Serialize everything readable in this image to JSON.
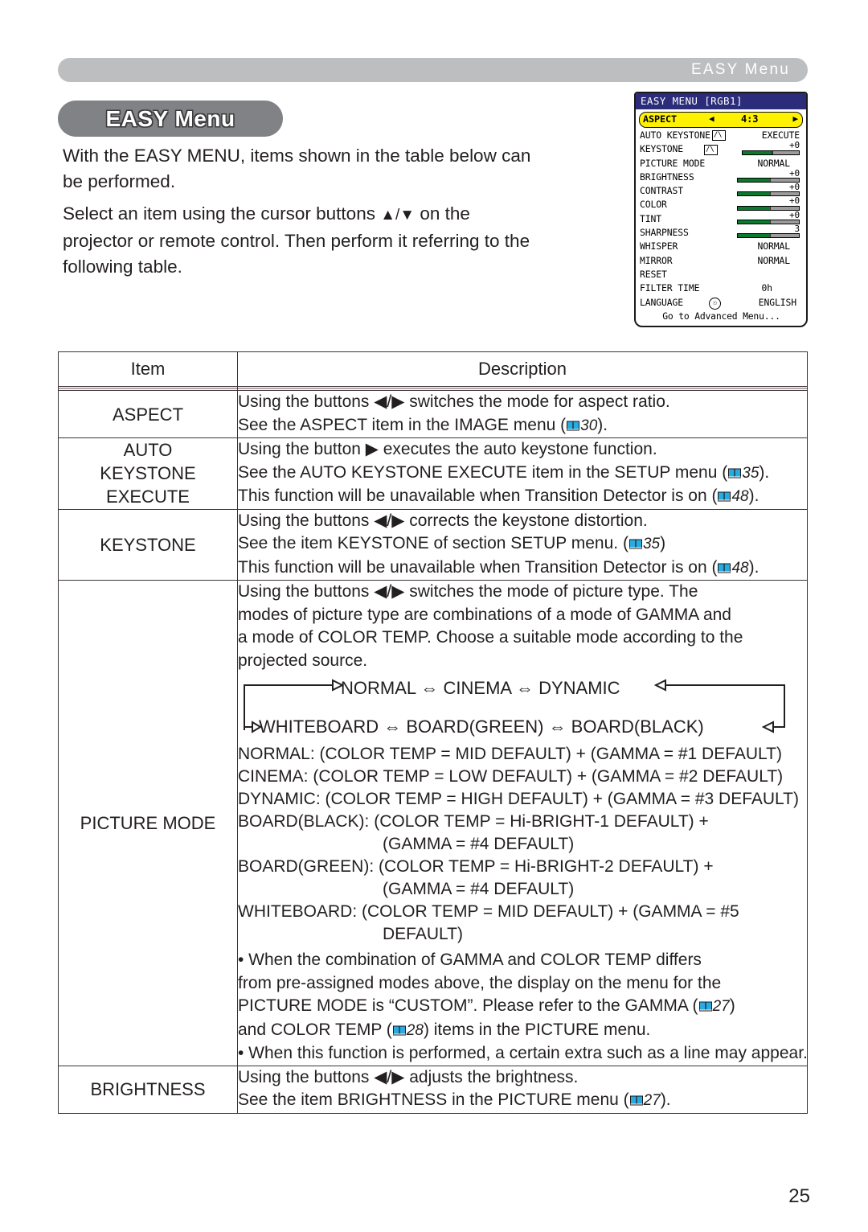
{
  "header": {
    "title": "EASY Menu"
  },
  "section": {
    "badge": "EASY Menu"
  },
  "intro": {
    "p1_line1": "With the EASY MENU, items shown in the table below can",
    "p1_line2": "be performed.",
    "p2_line1a": "Select an item using the cursor buttons ",
    "p2_symbols": "▲/▼",
    "p2_line1b": " on the",
    "p2_line2": "projector or remote control. Then perform it referring to the",
    "p2_line3": "following table."
  },
  "osd": {
    "title": "EASY MENU [RGB1]",
    "selected": {
      "label": "ASPECT",
      "value": "4:3",
      "left_arrow": "◀",
      "right_arrow": "▶"
    },
    "rows": [
      {
        "label": "AUTO KEYSTONE",
        "icon": "keystone-icon",
        "value": "EXECUTE",
        "type": "text"
      },
      {
        "label": "KEYSTONE",
        "icon": "keystone-icon",
        "value": "+0",
        "type": "bar",
        "fill": 52
      },
      {
        "label": "PICTURE MODE",
        "value": "NORMAL",
        "type": "text"
      },
      {
        "label": "BRIGHTNESS",
        "value": "+0",
        "type": "bar",
        "fill": 52
      },
      {
        "label": "CONTRAST",
        "value": "+0",
        "type": "bar",
        "fill": 52
      },
      {
        "label": "COLOR",
        "value": "+0",
        "type": "bar",
        "fill": 52
      },
      {
        "label": "TINT",
        "value": "+0",
        "type": "bar",
        "fill": 52
      },
      {
        "label": "SHARPNESS",
        "value": "3",
        "type": "bar",
        "fill": 52
      },
      {
        "label": "WHISPER",
        "value": "NORMAL",
        "type": "text"
      },
      {
        "label": "MIRROR",
        "value": "NORMAL",
        "type": "text"
      },
      {
        "label": "RESET",
        "value": "",
        "type": "text"
      },
      {
        "label": "FILTER TIME",
        "value": "0h",
        "type": "text"
      },
      {
        "label": "LANGUAGE",
        "icon": "globe-icon",
        "value": "ENGLISH",
        "type": "text"
      }
    ],
    "footer": "Go to Advanced Menu..."
  },
  "table": {
    "headers": {
      "item": "Item",
      "description": "Description"
    },
    "rows": [
      {
        "item": "ASPECT",
        "desc": [
          "Using the buttons ◀/▶ switches the mode for aspect ratio.",
          "See the ASPECT item in the IMAGE menu (▯30)."
        ],
        "lines": [
          {
            "pre": "Using the buttons ◀/▶ switches the mode for aspect ratio.",
            "ref": null,
            "post": ""
          },
          {
            "pre": "See the ASPECT item in the IMAGE menu (",
            "ref": "30",
            "post": ")."
          }
        ]
      },
      {
        "item": "AUTO\nKEYSTONE\nEXECUTE",
        "item_lines": [
          "AUTO",
          "KEYSTONE",
          "EXECUTE"
        ],
        "lines": [
          {
            "pre": "Using the button ▶ executes the auto keystone function.",
            "ref": null,
            "post": ""
          },
          {
            "pre": "See the AUTO KEYSTONE EXECUTE item in the SETUP menu (",
            "ref": "35",
            "post": ")."
          },
          {
            "pre": "This function will be unavailable when Transition Detector is on (",
            "ref": "48",
            "post": ")."
          }
        ]
      },
      {
        "item": "KEYSTONE",
        "item_lines": [
          "KEYSTONE"
        ],
        "lines": [
          {
            "pre": "Using the buttons ◀/▶ corrects the keystone distortion.",
            "ref": null,
            "post": ""
          },
          {
            "pre": "See the item KEYSTONE of section SETUP menu. (",
            "ref": "35",
            "post": ")"
          },
          {
            "pre": "This function will be unavailable when Transition Detector is on (",
            "ref": "48",
            "post": ")."
          }
        ]
      },
      {
        "item": "PICTURE MODE",
        "item_lines": [
          "PICTURE MODE"
        ],
        "intro_lines": [
          "Using the buttons ◀/▶ switches the mode of picture type. The",
          "modes of picture type are combinations of a mode of GAMMA and",
          "a mode of COLOR TEMP. Choose a suitable mode according to the",
          "projected source."
        ],
        "cycle": {
          "row1": "NORMAL ⇔ CINEMA ⇔ DYNAMIC",
          "row2": "WHITEBOARD ⇔ BOARD(GREEN) ⇔ BOARD(BLACK)"
        },
        "mode_lines": [
          "NORMAL: (COLOR TEMP = MID DEFAULT) + (GAMMA = #1 DEFAULT)",
          "CINEMA: (COLOR TEMP = LOW DEFAULT) + (GAMMA = #2 DEFAULT)",
          "DYNAMIC: (COLOR TEMP = HIGH DEFAULT) + (GAMMA = #3 DEFAULT)",
          "BOARD(BLACK): (COLOR TEMP = Hi-BRIGHT-1 DEFAULT) +",
          "(GAMMA = #4 DEFAULT)",
          "BOARD(GREEN): (COLOR TEMP = Hi-BRIGHT-2 DEFAULT) +",
          "(GAMMA = #4 DEFAULT)",
          "WHITEBOARD: (COLOR TEMP = MID DEFAULT) + (GAMMA = #5",
          "DEFAULT)"
        ],
        "bullet_lines": [
          {
            "pre": "• When the combination of GAMMA and COLOR TEMP differs",
            "ref": null,
            "post": ""
          },
          {
            "pre": "from pre-assigned modes above, the display on the menu for the",
            "ref": null,
            "post": ""
          },
          {
            "pre": "PICTURE MODE is “CUSTOM”. Please refer to the GAMMA (",
            "ref": "27",
            "post": ")"
          },
          {
            "pre": "and COLOR TEMP (",
            "ref": "28",
            "post": ") items in the PICTURE menu."
          },
          {
            "pre": "• When this function is performed, a certain extra such as a line may appear.",
            "ref": null,
            "post": ""
          }
        ]
      },
      {
        "item": "BRIGHTNESS",
        "item_lines": [
          "BRIGHTNESS"
        ],
        "lines": [
          {
            "pre": "Using the buttons ◀/▶ adjusts the brightness.",
            "ref": null,
            "post": ""
          },
          {
            "pre": "See the item BRIGHTNESS in the PICTURE menu (",
            "ref": "27",
            "post": ")."
          }
        ]
      }
    ]
  },
  "page_number": "25",
  "colors": {
    "header_bar": "#bcbec0",
    "badge": "#808285",
    "osd_title": "#2b2d7a",
    "osd_highlight": "#fff200",
    "bar_fill": "#0a7a2f",
    "book_icon": "#29abe2"
  }
}
